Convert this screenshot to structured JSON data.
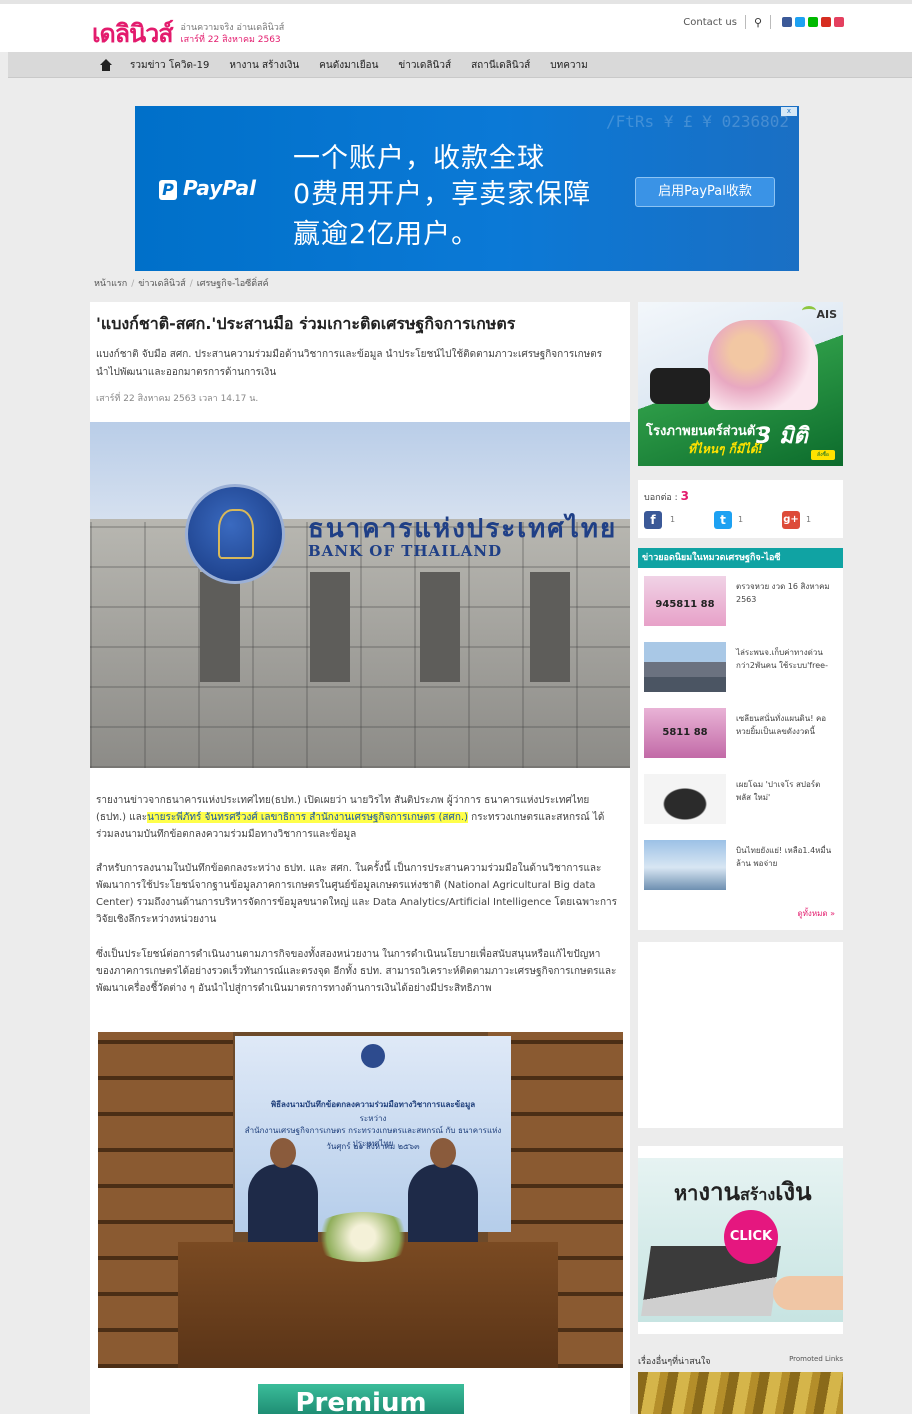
{
  "header": {
    "logo": "เดลินิวส์",
    "tagline": "อ่านความจริง อ่านเดลินิวส์",
    "date": "เสาร์ที่ 22 สิงหาคม 2563",
    "contact": "Contact us"
  },
  "nav": {
    "items": [
      "รวมข่าว โควิด-19",
      "หางาน สร้างเงิน",
      "คนดังมาเยือน",
      "ข่าวเดลินิวส์",
      "สถานีเดลินิวส์",
      "บทความ"
    ]
  },
  "ad_banner": {
    "brand": "PayPal",
    "line1": "一个账户，收款全球",
    "line2": "0费用开户，享卖家保障",
    "line3": "赢逾2亿用户。",
    "cta": "启用PayPal收款",
    "close": "x"
  },
  "breadcrumb": [
    "หน้าแรก",
    "ข่าวเดลินิวส์",
    "เศรษฐกิจ-ไอซีติ่สค์"
  ],
  "article": {
    "title": "'แบงก์ชาติ-สศก.'ประสานมือ ร่วมเกาะติดเศรษฐกิจการเกษตร",
    "lead": "แบงก์ชาติ จับมือ สศก. ประสานความร่วมมือด้านวิชาการและข้อมูล นำประโยชน์ไปใช้ติดตามภาวะเศรษฐกิจการเกษตร นำไปพัฒนาและออกมาตรการด้านการเงิน",
    "published": "เสาร์ที่ 22 สิงหาคม 2563 เวลา 14.17 น.",
    "photo1_th": "ธนาคารแห่งประเทศไทย",
    "photo1_en": "BANK OF THAILAND",
    "p1_a": "รายงานข่าวจากธนาคารแห่งประเทศไทย(ธปท.) เปิดเผยว่า นายวิรไท สันติประภพ ผู้ว่าการ ธนาคารแห่งประเทศไทย (ธปท.) และ",
    "p1_hl": "นายระพีภัทร์ จันทรศรีวงศ์ เลขาธิการ สำนักงานเศรษฐกิจการเกษตร (สศก.)",
    "p1_b": " กระทรวงเกษตรและสหกรณ์ ได้ร่วมลงนามบันทึกข้อตกลงความร่วมมือทางวิชาการและข้อมูล",
    "p2": "สำหรับการลงนามในบันทึกข้อตกลงระหว่าง ธปท. และ สศก. ในครั้งนี้ เป็นการประสานความร่วมมือในด้านวิชาการและพัฒนาการใช้ประโยชน์จากฐานข้อมูลภาคการเกษตรในศูนย์ข้อมูลเกษตรแห่งชาติ (National Agricultural Big data Center) รวมถึงงานด้านการบริหารจัดการข้อมูลขนาดใหญ่ และ Data Analytics/Artificial Intelligence โดยเฉพาะการวิจัยเชิงลึกระหว่างหน่วยงาน",
    "p3": "ซึ่งเป็นประโยชน์ต่อการดำเนินงานตามภารกิจของทั้งสองหน่วยงาน ในการดำเนินนโยบายเพื่อสนับสนุนหรือแก้ไขปัญหาของภาคการเกษตรได้อย่างรวดเร็วทันการณ์และตรงจุด อีกทั้ง ธปท. สามารถวิเคราะห์ติดตามภาวะเศรษฐกิจการเกษตรและพัฒนาเครื่องชี้วัดต่าง ๆ อันนำไปสู่การดำเนินมาตรการทางด้านการเงินได้อย่างมีประสิทธิภาพ",
    "backdrop_line1": "พิธีลงนามบันทึกข้อตกลงความร่วมมือทางวิชาการและข้อมูล",
    "backdrop_line2": "ระหว่าง",
    "backdrop_line3": "สำนักงานเศรษฐกิจการเกษตร กระทรวงเกษตรและสหกรณ์ กับ ธนาคารแห่งประเทศไทย",
    "backdrop_line4": "วันศุกร์ ๒๑ สิงหาคม ๒๕๖๓",
    "premium": "Premium"
  },
  "sidebar": {
    "ad1": {
      "brand": "AIS",
      "line1": "โรงภาพยนตร์ส่วนตัว",
      "line2": "ที่ไหนๆ ก็มีได้!",
      "big": "3 มิติ",
      "btn": "สั่งซื้อ"
    },
    "share": {
      "label": "บอกต่อ :",
      "total": "3",
      "fb": "f",
      "fb_count": "1",
      "tw": "t",
      "tw_count": "1",
      "gp": "g+",
      "gp_count": "1"
    },
    "popular": {
      "heading": "ข่าวยอดนิยมในหมวดเศรษฐกิจ-ไอซี",
      "items": [
        {
          "text": "ตรวจหวย งวด 16 สิงหาคม 2563",
          "thumb_text": "945811  88"
        },
        {
          "text": "ไล่ระพนจ.เก็บค่าทางด่วน กว่า2พันคน ใช้ระบบ'free-",
          "thumb_text": ""
        },
        {
          "text": "เซลียนสนั่นทั่งแผนดิน! คอหวยยิ้มเป็นเลขดังงวดนี้",
          "thumb_text": "5811  88"
        },
        {
          "text": "เผยโฉม 'ปาเจโร สปอร์ต พลัส ใหม่'",
          "thumb_text": ""
        },
        {
          "text": "บินไทยยังแย่! เหลือ1.4หมื่นล้าน พอจ่าย",
          "thumb_text": ""
        }
      ],
      "more": "ดูทั้งหมด »"
    },
    "ad2": {
      "title_a": "หา",
      "title_b": "งาน",
      "title_c": "สร้าง",
      "title_d": "เงิน",
      "click": "CLICK"
    },
    "more_heading": "เรื่องอื่นๆที่น่าสนใจ",
    "promoted": "Promoted Links"
  },
  "colors": {
    "brand_pink": "#e31b6d",
    "popular_teal": "#10a3a3",
    "paypal_blue": "#0070c9",
    "highlight": "#ffff4a"
  }
}
